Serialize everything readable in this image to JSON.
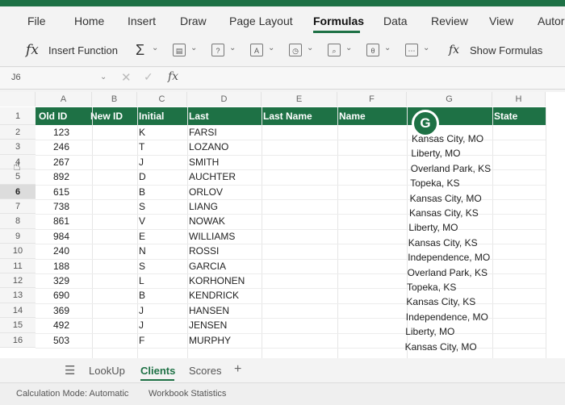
{
  "menu": {
    "items": [
      "File",
      "Home",
      "Insert",
      "Draw",
      "Page Layout",
      "Formulas",
      "Data",
      "Review",
      "View",
      "Autor"
    ],
    "active": "Formulas"
  },
  "ribbon": {
    "insert_function": "Insert Function",
    "show_formulas": "Show Formulas"
  },
  "formula_bar": {
    "name_box": "J6",
    "fx": "fx"
  },
  "columns": [
    "A",
    "B",
    "C",
    "D",
    "E",
    "F",
    "G",
    "H"
  ],
  "headers": {
    "old_id": "Old ID",
    "new_id": "New ID",
    "initial": "Initial",
    "last": "Last",
    "last_name": "Last Name",
    "name": "Name",
    "state": "State"
  },
  "avatar_letter": "G",
  "row_numbers": [
    "1",
    "2",
    "3",
    "4",
    "5",
    "6",
    "7",
    "8",
    "9",
    "10",
    "11",
    "12",
    "13",
    "14",
    "15",
    "16"
  ],
  "selected_row": "6",
  "rows": [
    {
      "old_id": "123",
      "initial": "K",
      "last": "FARSI"
    },
    {
      "old_id": "246",
      "initial": "T",
      "last": "LOZANO"
    },
    {
      "old_id": "267",
      "initial": "J",
      "last": "SMITH"
    },
    {
      "old_id": "892",
      "initial": "D",
      "last": "AUCHTER"
    },
    {
      "old_id": "615",
      "initial": "B",
      "last": "ORLOV"
    },
    {
      "old_id": "738",
      "initial": "S",
      "last": "LIANG"
    },
    {
      "old_id": "861",
      "initial": "V",
      "last": "NOWAK"
    },
    {
      "old_id": "984",
      "initial": "E",
      "last": "WILLIAMS"
    },
    {
      "old_id": "240",
      "initial": "N",
      "last": "ROSSI"
    },
    {
      "old_id": "188",
      "initial": "S",
      "last": "GARCIA"
    },
    {
      "old_id": "329",
      "initial": "L",
      "last": "KORHONEN"
    },
    {
      "old_id": "690",
      "initial": "B",
      "last": "KENDRICK"
    },
    {
      "old_id": "369",
      "initial": "J",
      "last": "HANSEN"
    },
    {
      "old_id": "492",
      "initial": "J",
      "last": "JENSEN"
    },
    {
      "old_id": "503",
      "initial": "F",
      "last": "MURPHY"
    }
  ],
  "locations": [
    "Kansas City, MO",
    "Liberty, MO",
    "Overland Park, KS",
    "Topeka, KS",
    "Kansas City, MO",
    "Kansas City, KS",
    "Liberty, MO",
    "Kansas City, KS",
    "Independence, MO",
    "Overland Park, KS",
    "Topeka, KS",
    "Kansas City, KS",
    "Independence, MO",
    "Liberty, MO",
    "Kansas City, MO"
  ],
  "sheet_tabs": [
    "LookUp",
    "Clients",
    "Scores"
  ],
  "active_sheet": "Clients",
  "sheet_add": "+",
  "status": {
    "calc_mode": "Calculation Mode: Automatic",
    "workbook_stats": "Workbook Statistics"
  },
  "colors": {
    "accent": "#1e7145",
    "header_text": "#ffffff"
  }
}
